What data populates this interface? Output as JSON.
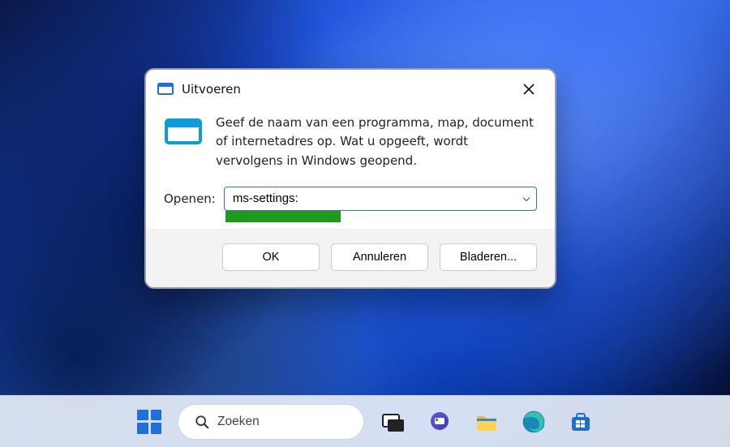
{
  "dialog": {
    "title": "Uitvoeren",
    "description": "Geef de naam van een programma, map, document of internetadres op. Wat u opgeeft, wordt vervolgens in Windows geopend.",
    "open_label": "Openen:",
    "open_value": "ms-settings:",
    "buttons": {
      "ok": "OK",
      "cancel": "Annuleren",
      "browse": "Bladeren..."
    }
  },
  "taskbar": {
    "search_placeholder": "Zoeken"
  },
  "icons": {
    "run": "run-icon",
    "close": "close-icon",
    "chevron_down": "chevron-down-icon",
    "start": "start-icon",
    "search": "search-icon",
    "task_view": "task-view-icon",
    "chat": "chat-icon",
    "explorer": "file-explorer-icon",
    "edge": "edge-icon",
    "store": "store-icon"
  },
  "colors": {
    "accent": "#1e6fe0",
    "highlight_bar": "#1f9a1f",
    "dialog_border": "#9aa0a6"
  }
}
